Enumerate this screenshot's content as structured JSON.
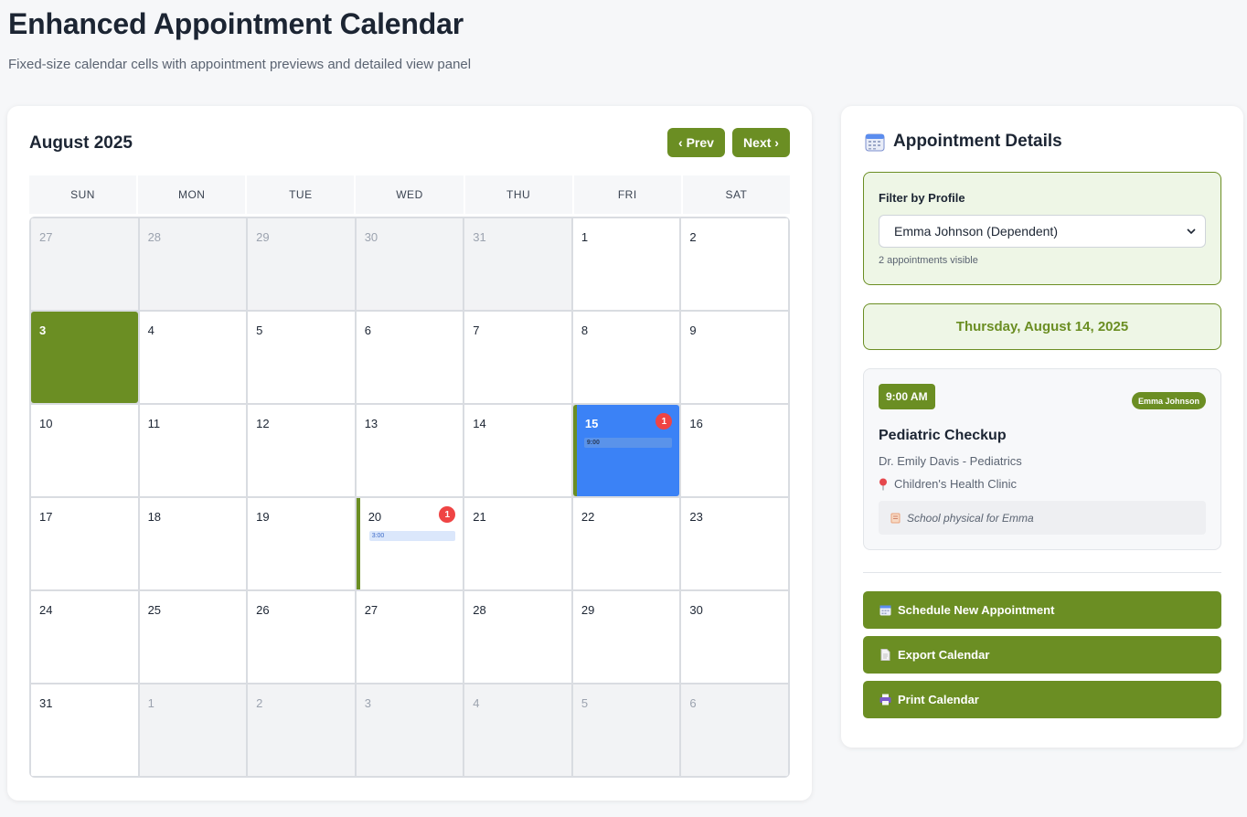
{
  "page": {
    "title": "Enhanced Appointment Calendar",
    "subtitle": "Fixed-size calendar cells with appointment previews and detailed view panel"
  },
  "calendar": {
    "month_label": "August 2025",
    "prev_label": "‹ Prev",
    "next_label": "Next ›",
    "weekdays": [
      "SUN",
      "MON",
      "TUE",
      "WED",
      "THU",
      "FRI",
      "SAT"
    ],
    "days": [
      {
        "n": "27",
        "state": "other"
      },
      {
        "n": "28",
        "state": "other"
      },
      {
        "n": "29",
        "state": "other"
      },
      {
        "n": "30",
        "state": "other"
      },
      {
        "n": "31",
        "state": "other"
      },
      {
        "n": "1",
        "state": "current"
      },
      {
        "n": "2",
        "state": "current"
      },
      {
        "n": "3",
        "state": "today"
      },
      {
        "n": "4",
        "state": "current"
      },
      {
        "n": "5",
        "state": "current"
      },
      {
        "n": "6",
        "state": "current"
      },
      {
        "n": "7",
        "state": "current"
      },
      {
        "n": "8",
        "state": "current"
      },
      {
        "n": "9",
        "state": "current"
      },
      {
        "n": "10",
        "state": "current"
      },
      {
        "n": "11",
        "state": "current"
      },
      {
        "n": "12",
        "state": "current"
      },
      {
        "n": "13",
        "state": "current"
      },
      {
        "n": "14",
        "state": "current"
      },
      {
        "n": "15",
        "state": "selected",
        "badge": "1",
        "preview": "9:00"
      },
      {
        "n": "16",
        "state": "current"
      },
      {
        "n": "17",
        "state": "current"
      },
      {
        "n": "18",
        "state": "current"
      },
      {
        "n": "19",
        "state": "current"
      },
      {
        "n": "20",
        "state": "has-appt",
        "badge": "1",
        "preview": "3:00"
      },
      {
        "n": "21",
        "state": "current"
      },
      {
        "n": "22",
        "state": "current"
      },
      {
        "n": "23",
        "state": "current"
      },
      {
        "n": "24",
        "state": "current"
      },
      {
        "n": "25",
        "state": "current"
      },
      {
        "n": "26",
        "state": "current"
      },
      {
        "n": "27",
        "state": "current"
      },
      {
        "n": "28",
        "state": "current"
      },
      {
        "n": "29",
        "state": "current"
      },
      {
        "n": "30",
        "state": "current"
      },
      {
        "n": "31",
        "state": "current"
      },
      {
        "n": "1",
        "state": "other"
      },
      {
        "n": "2",
        "state": "other"
      },
      {
        "n": "3",
        "state": "other"
      },
      {
        "n": "4",
        "state": "other"
      },
      {
        "n": "5",
        "state": "other"
      },
      {
        "n": "6",
        "state": "other"
      }
    ]
  },
  "details": {
    "title": "Appointment Details",
    "title_icon": "calendar-icon",
    "filter": {
      "label": "Filter by Profile",
      "selected": "Emma Johnson (Dependent)",
      "count_text": "2 appointments visible"
    },
    "selected_date": "Thursday, August 14, 2025",
    "appointment": {
      "time": "9:00 AM",
      "profile": "Emma Johnson",
      "title": "Pediatric Checkup",
      "doctor": "Dr. Emily Davis - Pediatrics",
      "location": "Children's Health Clinic",
      "location_icon": "pin-icon",
      "note": "School physical for Emma",
      "note_icon": "memo-icon"
    },
    "actions": [
      {
        "label": "Schedule New Appointment",
        "icon": "calendar-icon"
      },
      {
        "label": "Export Calendar",
        "icon": "document-icon"
      },
      {
        "label": "Print Calendar",
        "icon": "printer-icon"
      }
    ]
  },
  "colors": {
    "primary": "#6b8e23",
    "selected_day": "#3b82f6",
    "badge": "#ef4444",
    "panel_tint": "#eef6e6"
  }
}
